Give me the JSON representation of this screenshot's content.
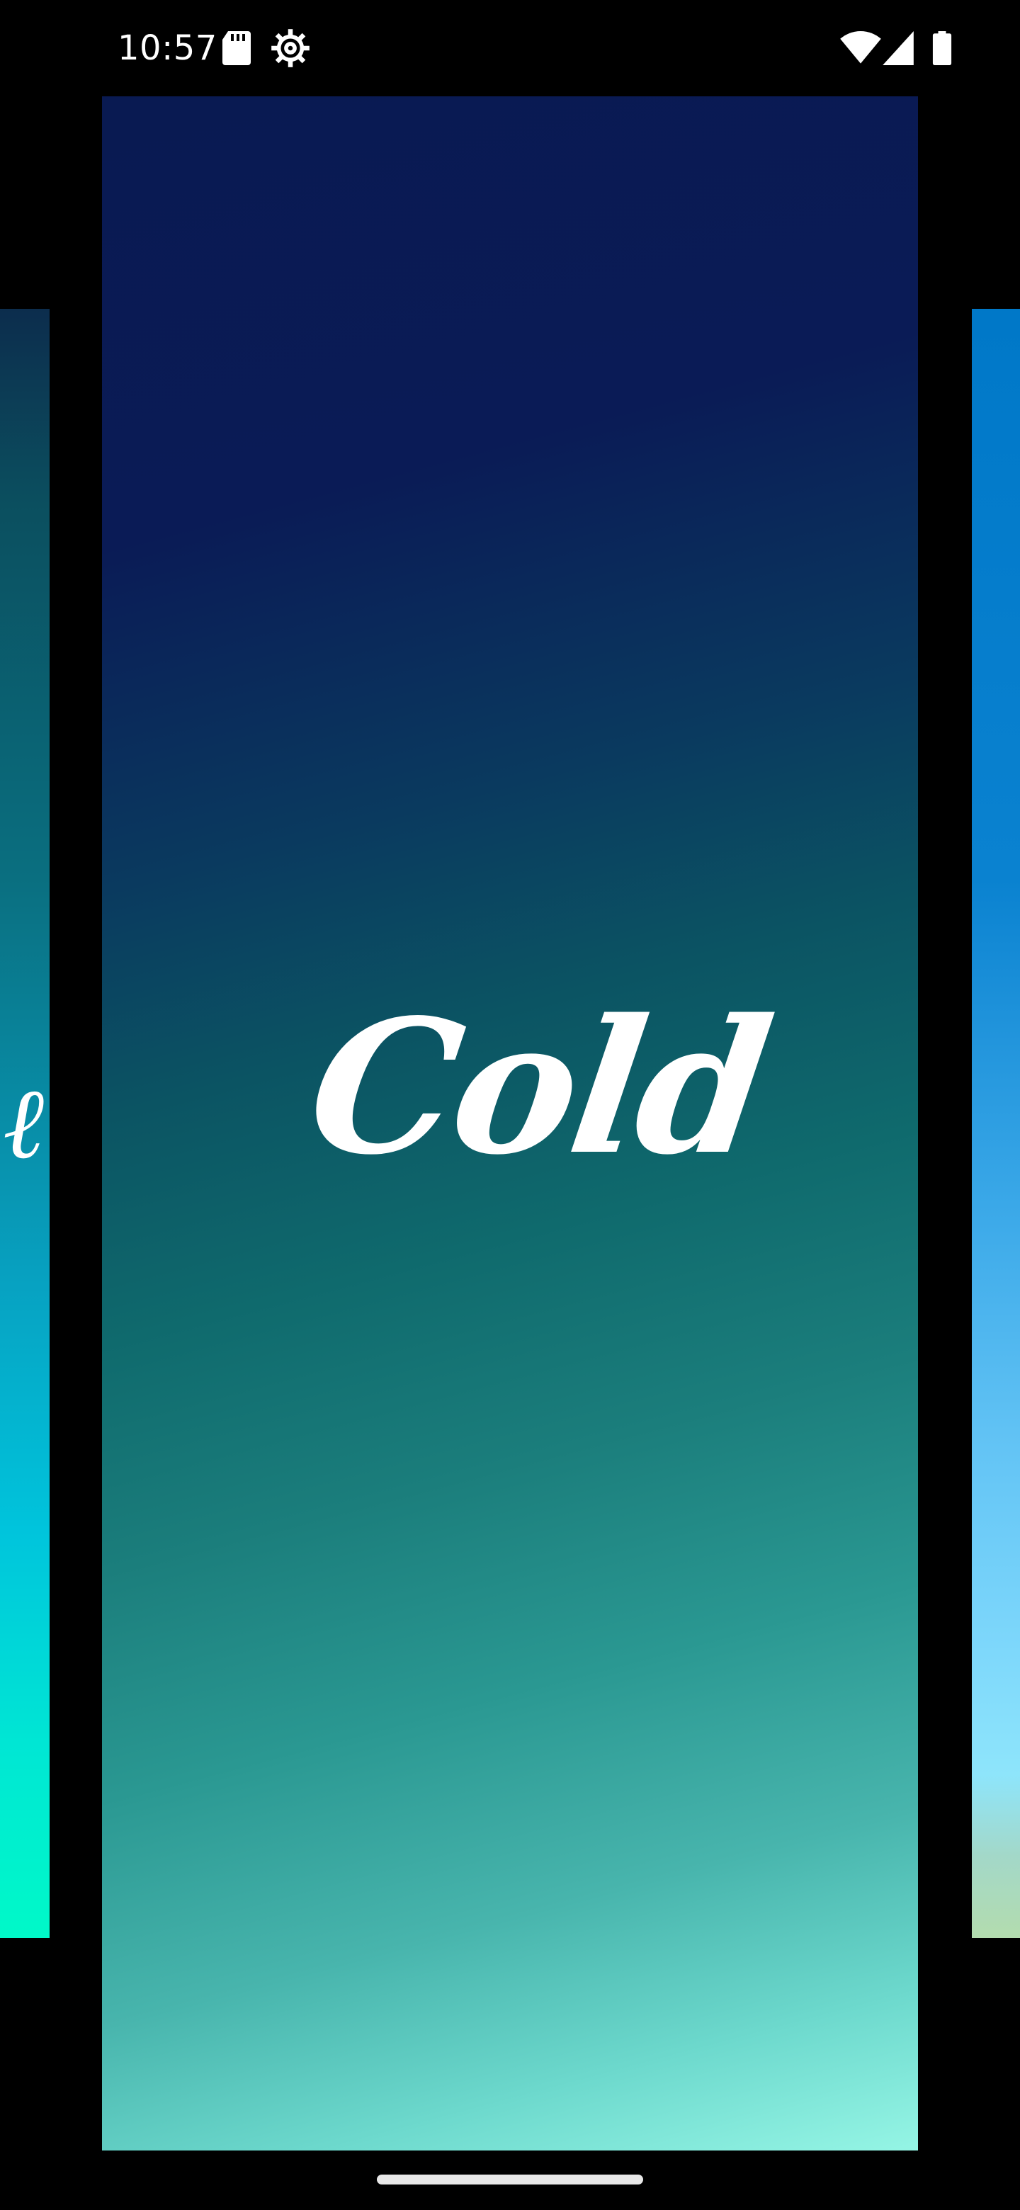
{
  "status_bar": {
    "time": "10:57",
    "left_icons": [
      "sd-card-icon",
      "gear-icon"
    ],
    "right_icons": [
      "wifi-icon",
      "signal-icon",
      "battery-icon"
    ]
  },
  "carousel": {
    "center_card": {
      "title": "Cold",
      "gradient_colors": [
        "#091a52",
        "#0b5463",
        "#2a9892",
        "#95f5e5"
      ]
    },
    "left_card": {
      "gradient_colors": [
        "#0c2d4d",
        "#0a6f80",
        "#00c4dc",
        "#00f9c8"
      ]
    },
    "right_card": {
      "gradient_colors": [
        "#0078c8",
        "#3aa8e8",
        "#8ee5fb",
        "#b3dcae"
      ]
    }
  },
  "colors": {
    "background": "#000000",
    "text": "#ffffff",
    "nav_handle": "#e8e8e8"
  }
}
